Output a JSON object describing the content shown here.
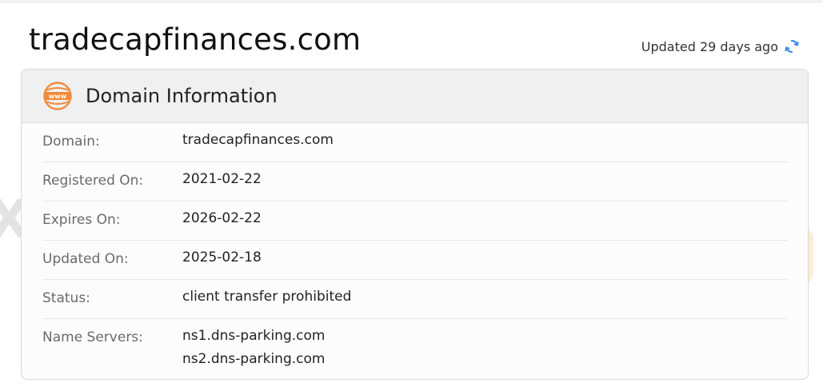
{
  "header": {
    "site_title": "tradecapfinances.com",
    "updated_text": "Updated 29 days ago"
  },
  "card": {
    "title": "Domain Information",
    "icon_name": "www-icon",
    "icon_color": "#f08a3c",
    "rows": [
      {
        "label": "Domain:",
        "value": "tradecapfinances.com"
      },
      {
        "label": "Registered On:",
        "value": "2021-02-22"
      },
      {
        "label": "Expires On:",
        "value": "2026-02-22"
      },
      {
        "label": "Updated On:",
        "value": "2025-02-18"
      },
      {
        "label": "Status:",
        "value": "client transfer prohibited"
      }
    ],
    "name_servers": {
      "label": "Name Servers:",
      "values": [
        "ns1.dns-parking.com",
        "ns2.dns-parking.com"
      ]
    }
  },
  "watermark": {
    "text": "WikiFX",
    "partial_text": "X"
  },
  "colors": {
    "refresh_icon": "#3a8ee6",
    "accent_orange": "#f08a3c"
  }
}
